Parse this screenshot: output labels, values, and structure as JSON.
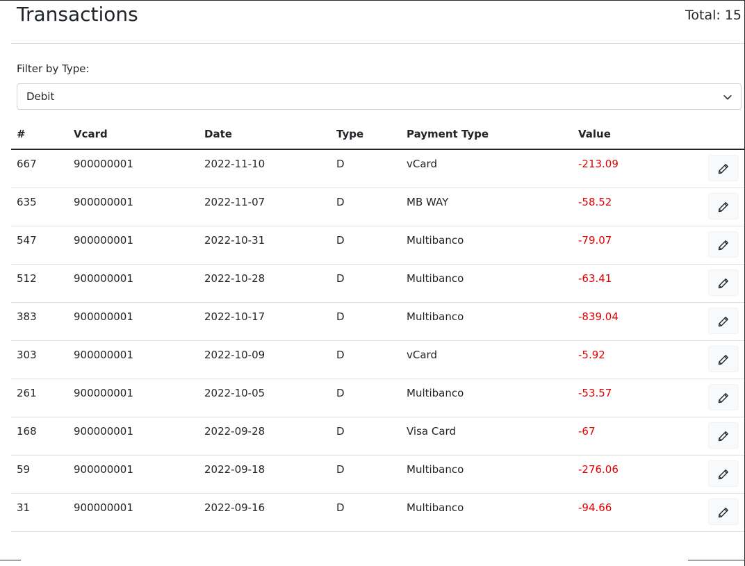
{
  "header": {
    "title": "Transactions",
    "total": "Total: 15"
  },
  "filter": {
    "label": "Filter by Type:",
    "selected": "Debit"
  },
  "table": {
    "columns": [
      "#",
      "Vcard",
      "Date",
      "Type",
      "Payment Type",
      "Value"
    ],
    "rows": [
      {
        "id": "667",
        "vcard": "900000001",
        "date": "2022-11-10",
        "type": "D",
        "payment_type": "vCard",
        "value": "-213.09"
      },
      {
        "id": "635",
        "vcard": "900000001",
        "date": "2022-11-07",
        "type": "D",
        "payment_type": "MB WAY",
        "value": "-58.52"
      },
      {
        "id": "547",
        "vcard": "900000001",
        "date": "2022-10-31",
        "type": "D",
        "payment_type": "Multibanco",
        "value": "-79.07"
      },
      {
        "id": "512",
        "vcard": "900000001",
        "date": "2022-10-28",
        "type": "D",
        "payment_type": "Multibanco",
        "value": "-63.41"
      },
      {
        "id": "383",
        "vcard": "900000001",
        "date": "2022-10-17",
        "type": "D",
        "payment_type": "Multibanco",
        "value": "-839.04"
      },
      {
        "id": "303",
        "vcard": "900000001",
        "date": "2022-10-09",
        "type": "D",
        "payment_type": "vCard",
        "value": "-5.92"
      },
      {
        "id": "261",
        "vcard": "900000001",
        "date": "2022-10-05",
        "type": "D",
        "payment_type": "Multibanco",
        "value": "-53.57"
      },
      {
        "id": "168",
        "vcard": "900000001",
        "date": "2022-09-28",
        "type": "D",
        "payment_type": "Visa Card",
        "value": "-67"
      },
      {
        "id": "59",
        "vcard": "900000001",
        "date": "2022-09-18",
        "type": "D",
        "payment_type": "Multibanco",
        "value": "-276.06"
      },
      {
        "id": "31",
        "vcard": "900000001",
        "date": "2022-09-16",
        "type": "D",
        "payment_type": "Multibanco",
        "value": "-94.66"
      }
    ],
    "row_action_icon": "pencil-icon"
  },
  "colors": {
    "negative_value": "#e00000",
    "header_rule": "#212529",
    "row_rule": "#dee2e6"
  }
}
